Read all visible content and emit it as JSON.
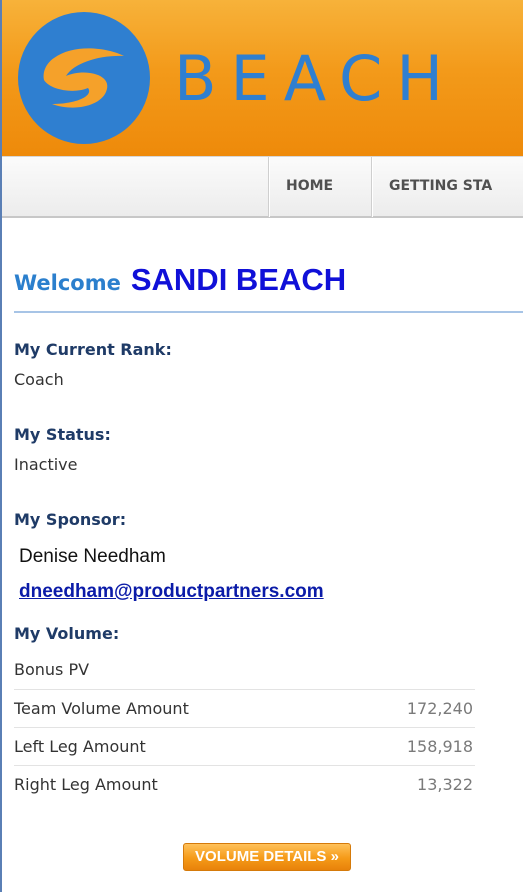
{
  "header": {
    "brand_text": "BEACH",
    "logo_icon": "beach-logo-icon",
    "colors": {
      "bar": "#f39a1a",
      "brand_text": "#2f7fd0",
      "logo_globe": "#2f7fd0"
    }
  },
  "nav": {
    "items": [
      {
        "label": "HOME"
      },
      {
        "label": "GETTING STA"
      }
    ]
  },
  "welcome": {
    "label": "Welcome",
    "name": "SANDI BEACH"
  },
  "rank": {
    "label": "My Current Rank:",
    "value": "Coach"
  },
  "status": {
    "label": "My Status:",
    "value": "Inactive"
  },
  "sponsor": {
    "label": "My Sponsor:",
    "name": "Denise Needham",
    "email": "dneedham@productpartners.com"
  },
  "volume": {
    "label": "My Volume:",
    "rows": [
      {
        "label": "Bonus PV",
        "amount": ""
      },
      {
        "label": "Team Volume Amount",
        "amount": "172,240"
      },
      {
        "label": "Left Leg Amount",
        "amount": "158,918"
      },
      {
        "label": "Right Leg Amount",
        "amount": "13,322"
      }
    ],
    "details_button": "VOLUME DETAILS »"
  }
}
